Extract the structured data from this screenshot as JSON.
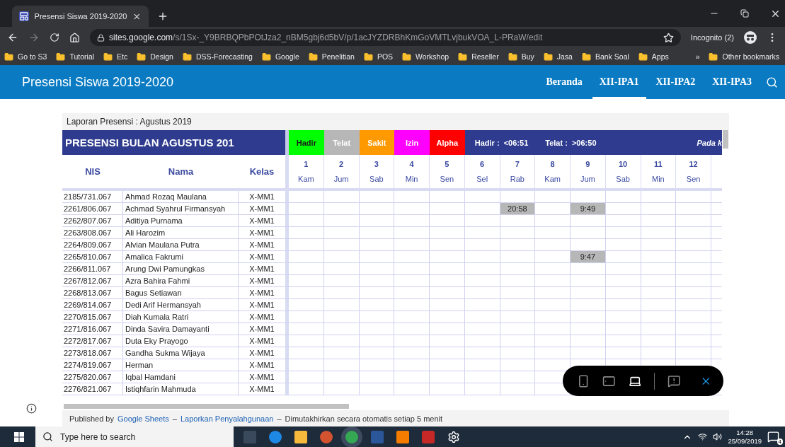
{
  "browser": {
    "tab_title": "Presensi Siswa 2019-2020",
    "url_host": "sites.google.com",
    "url_path": "/s/1Sx-_Y9BRBQPbPOtJza2_nBM5gbj6d5bV/p/1acJYZDRBhKmGoVMTLvjbukVOA_L-PRaW/edit",
    "profile": "Incognito (2)",
    "bookmarks": [
      "Go to S3",
      "Tutorial",
      "Etc",
      "Design",
      "DSS-Forecasting",
      "Google",
      "Penelitian",
      "POS",
      "Workshop",
      "Reseller",
      "Buy",
      "Jasa",
      "Bank Soal",
      "Apps"
    ],
    "overflow": "»",
    "other_bookmarks": "Other bookmarks"
  },
  "site": {
    "title": "Presensi Siswa 2019-2020",
    "nav": [
      {
        "label": "Beranda",
        "selected": false
      },
      {
        "label": "XII-IPA1",
        "selected": true
      },
      {
        "label": "XII-IPA2",
        "selected": false
      },
      {
        "label": "XII-IPA3",
        "selected": false
      }
    ]
  },
  "sheet": {
    "caption": "Laporan Presensi : Agustus 2019",
    "heading": "PRESENSI BULAN AGUSTUS 201",
    "legend": [
      {
        "label": "Hadir",
        "color": "#00ff00"
      },
      {
        "label": "Telat",
        "color": "#b7b7b7"
      },
      {
        "label": "Sakit",
        "color": "#ff9900"
      },
      {
        "label": "Izin",
        "color": "#ff00ff"
      },
      {
        "label": "Alpha",
        "color": "#ff0000"
      }
    ],
    "notes": [
      "Hadir :  <06:51",
      "Telat :  >06:50"
    ],
    "note_right": "Pada k",
    "columns": [
      "NIS",
      "Nama",
      "Kelas"
    ],
    "days": [
      {
        "date": "1",
        "day": "Kam"
      },
      {
        "date": "2",
        "day": "Jum"
      },
      {
        "date": "3",
        "day": "Sab"
      },
      {
        "date": "4",
        "day": "Min"
      },
      {
        "date": "5",
        "day": "Sen"
      },
      {
        "date": "6",
        "day": "Sel"
      },
      {
        "date": "7",
        "day": "Rab"
      },
      {
        "date": "8",
        "day": "Kam"
      },
      {
        "date": "9",
        "day": "Jum"
      },
      {
        "date": "10",
        "day": "Sab"
      },
      {
        "date": "11",
        "day": "Min"
      },
      {
        "date": "12",
        "day": "Sen"
      }
    ],
    "rows": [
      {
        "nis": "2185/731.067",
        "nama": "Ahmad Rozaq Maulana",
        "kelas": "X-MM1",
        "cells": [
          null,
          null,
          null,
          null,
          null,
          null,
          null,
          null,
          null,
          null,
          null,
          null
        ]
      },
      {
        "nis": "2261/806.067",
        "nama": "Achmad Syahrul Firmansyah",
        "kelas": "X-MM1",
        "cells": [
          null,
          null,
          null,
          null,
          null,
          null,
          {
            "time": "20:58",
            "color": "#b7b7b7"
          },
          null,
          {
            "time": "9:49",
            "color": "#b7b7b7"
          },
          null,
          null,
          null
        ]
      },
      {
        "nis": "2262/807.067",
        "nama": "Aditiya Purnama",
        "kelas": "X-MM1",
        "cells": [
          null,
          null,
          null,
          null,
          null,
          null,
          null,
          null,
          null,
          null,
          null,
          null
        ]
      },
      {
        "nis": "2263/808.067",
        "nama": "Ali Harozim",
        "kelas": "X-MM1",
        "cells": [
          null,
          null,
          null,
          null,
          null,
          null,
          null,
          null,
          null,
          null,
          null,
          null
        ]
      },
      {
        "nis": "2264/809.067",
        "nama": "Alvian Maulana Putra",
        "kelas": "X-MM1",
        "cells": [
          null,
          null,
          null,
          null,
          null,
          null,
          null,
          null,
          null,
          null,
          null,
          null
        ]
      },
      {
        "nis": "2265/810.067",
        "nama": "Amalica Fakrumi",
        "kelas": "X-MM1",
        "cells": [
          null,
          null,
          null,
          null,
          null,
          null,
          null,
          null,
          {
            "time": "9:47",
            "color": "#b7b7b7"
          },
          null,
          null,
          null
        ]
      },
      {
        "nis": "2266/811.067",
        "nama": "Arung Dwi Pamungkas",
        "kelas": "X-MM1",
        "cells": [
          null,
          null,
          null,
          null,
          null,
          null,
          null,
          null,
          null,
          null,
          null,
          null
        ]
      },
      {
        "nis": "2267/812.067",
        "nama": "Azra Bahira Fahmi",
        "kelas": "X-MM1",
        "cells": [
          null,
          null,
          null,
          null,
          null,
          null,
          null,
          null,
          null,
          null,
          null,
          null
        ]
      },
      {
        "nis": "2268/813.067",
        "nama": "Bagus Setiawan",
        "kelas": "X-MM1",
        "cells": [
          null,
          null,
          null,
          null,
          null,
          null,
          null,
          null,
          null,
          null,
          null,
          null
        ]
      },
      {
        "nis": "2269/814.067",
        "nama": "Dedi Arif Hermansyah",
        "kelas": "X-MM1",
        "cells": [
          null,
          null,
          null,
          null,
          null,
          null,
          null,
          null,
          null,
          null,
          null,
          null
        ]
      },
      {
        "nis": "2270/815.067",
        "nama": "Diah Kumala Ratri",
        "kelas": "X-MM1",
        "cells": [
          null,
          null,
          null,
          null,
          null,
          null,
          null,
          null,
          null,
          null,
          null,
          null
        ]
      },
      {
        "nis": "2271/816.067",
        "nama": "Dinda Savira Damayanti",
        "kelas": "X-MM1",
        "cells": [
          null,
          null,
          null,
          null,
          null,
          null,
          null,
          null,
          null,
          null,
          null,
          null
        ]
      },
      {
        "nis": "2272/817.067",
        "nama": "Duta Eky Prayogo",
        "kelas": "X-MM1",
        "cells": [
          null,
          null,
          null,
          null,
          null,
          null,
          null,
          null,
          null,
          null,
          null,
          null
        ]
      },
      {
        "nis": "2273/818.067",
        "nama": "Gandha Sukma Wijaya",
        "kelas": "X-MM1",
        "cells": [
          null,
          null,
          null,
          null,
          null,
          null,
          null,
          null,
          null,
          null,
          null,
          null
        ]
      },
      {
        "nis": "2274/819.067",
        "nama": "Herman",
        "kelas": "X-MM1",
        "cells": [
          null,
          null,
          null,
          null,
          null,
          null,
          null,
          null,
          null,
          null,
          null,
          null
        ]
      },
      {
        "nis": "2275/820.067",
        "nama": "Iqbal Hamdani",
        "kelas": "X-MM1",
        "cells": [
          null,
          null,
          null,
          null,
          null,
          null,
          null,
          null,
          null,
          null,
          null,
          null
        ]
      },
      {
        "nis": "2276/821.067",
        "nama": "Istiqhfarin Mahmuda",
        "kelas": "X-MM1",
        "cells": [
          null,
          null,
          null,
          null,
          null,
          null,
          null,
          null,
          null,
          null,
          null,
          null
        ]
      }
    ]
  },
  "footer": [
    {
      "kind": "text",
      "text": "Published by"
    },
    {
      "kind": "link",
      "text": "Google Sheets"
    },
    {
      "kind": "text",
      "text": "–"
    },
    {
      "kind": "link",
      "text": "Laporkan Penyalahgunaan"
    },
    {
      "kind": "text",
      "text": "–"
    },
    {
      "kind": "text",
      "text": "Dimutakhirkan secara otomatis setiap 5 menit"
    }
  ],
  "view_bar": {
    "modes": [
      {
        "kind": "phone",
        "selected": false
      },
      {
        "kind": "tablet",
        "selected": false
      },
      {
        "kind": "laptop",
        "selected": true
      }
    ]
  },
  "taskbar": {
    "search_placeholder": "Type here to search",
    "time": "14:28",
    "date": "25/09/2019",
    "notifications": "4"
  }
}
